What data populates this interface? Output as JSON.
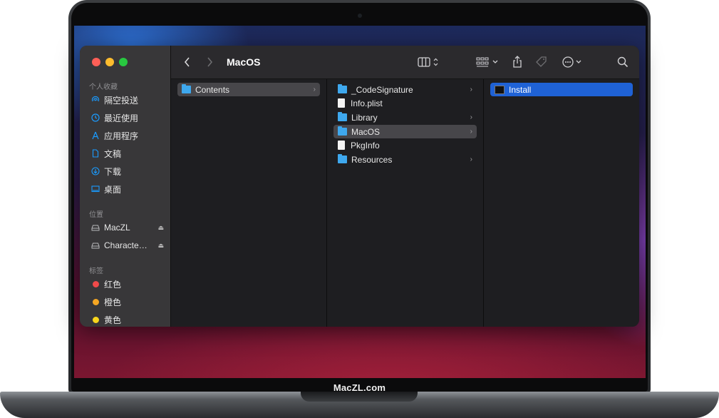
{
  "window": {
    "title": "MacOS"
  },
  "sidebar": {
    "favorites_header": "个人收藏",
    "favorites": [
      {
        "label": "隔空投送",
        "icon": "airdrop-icon"
      },
      {
        "label": "最近使用",
        "icon": "clock-icon"
      },
      {
        "label": "应用程序",
        "icon": "applications-icon"
      },
      {
        "label": "文稿",
        "icon": "document-icon"
      },
      {
        "label": "下载",
        "icon": "download-icon"
      },
      {
        "label": "桌面",
        "icon": "desktop-icon"
      }
    ],
    "locations_header": "位置",
    "locations": [
      {
        "label": "MacZL",
        "icon": "drive-icon"
      },
      {
        "label": "Characte…",
        "icon": "drive-icon"
      }
    ],
    "tags_header": "标签",
    "tags": [
      {
        "label": "红色",
        "color": "#f04a4a"
      },
      {
        "label": "橙色",
        "color": "#f5a623"
      },
      {
        "label": "黄色",
        "color": "#f8d51c"
      }
    ]
  },
  "columns": {
    "col1": [
      {
        "label": "Contents",
        "type": "folder",
        "selected": true
      }
    ],
    "col2": [
      {
        "label": "_CodeSignature",
        "type": "folder"
      },
      {
        "label": "Info.plist",
        "type": "file"
      },
      {
        "label": "Library",
        "type": "folder"
      },
      {
        "label": "MacOS",
        "type": "folder",
        "selected": true
      },
      {
        "label": "PkgInfo",
        "type": "file"
      },
      {
        "label": "Resources",
        "type": "folder"
      }
    ],
    "col3": [
      {
        "label": "Install",
        "type": "executable",
        "selected": true
      }
    ]
  },
  "laptop": {
    "brand": "MacZL.com"
  },
  "colors": {
    "selection_blue": "#1f62d6",
    "folder_blue": "#3ea8ee"
  }
}
